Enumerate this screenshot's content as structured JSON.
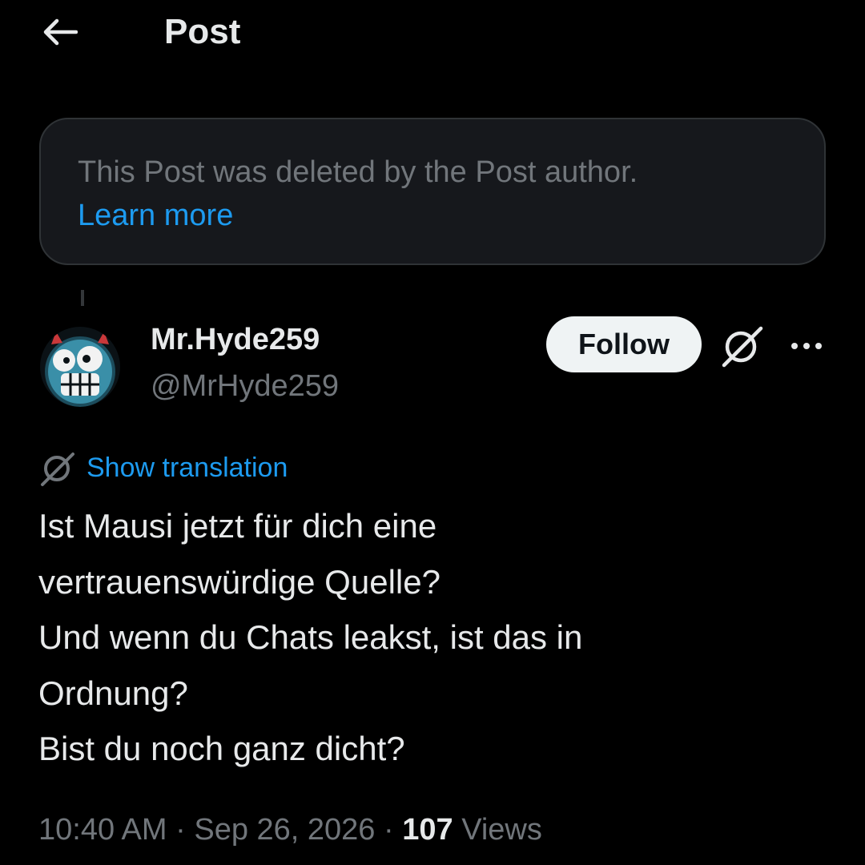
{
  "header": {
    "title": "Post"
  },
  "deleted_notice": {
    "text": "This Post was deleted by the Post author.",
    "link": "Learn more"
  },
  "author": {
    "display_name": "Mr.Hyde259",
    "handle": "@MrHyde259"
  },
  "follow_label": "Follow",
  "translation_label": "Show translation",
  "post_lines": [
    "Ist Mausi jetzt für dich eine",
    "vertrauenswürdige Quelle?",
    "Und wenn du Chats leakst, ist das in",
    "Ordnung?",
    "Bist du noch ganz dicht?"
  ],
  "meta": {
    "time": "10:40 AM",
    "separator": "·",
    "date": "Sep 26, 2026",
    "views_count": "107",
    "views_label": "Views"
  },
  "icons": {
    "back": "arrow-left-icon",
    "grok": "grok-icon",
    "more": "more-dots-icon",
    "translate": "grok-icon"
  },
  "colors": {
    "background": "#000000",
    "text": "#e7e9ea",
    "muted": "#71767b",
    "link": "#1d9bf0",
    "card": "#16181c",
    "follow_bg": "#eff3f4"
  }
}
